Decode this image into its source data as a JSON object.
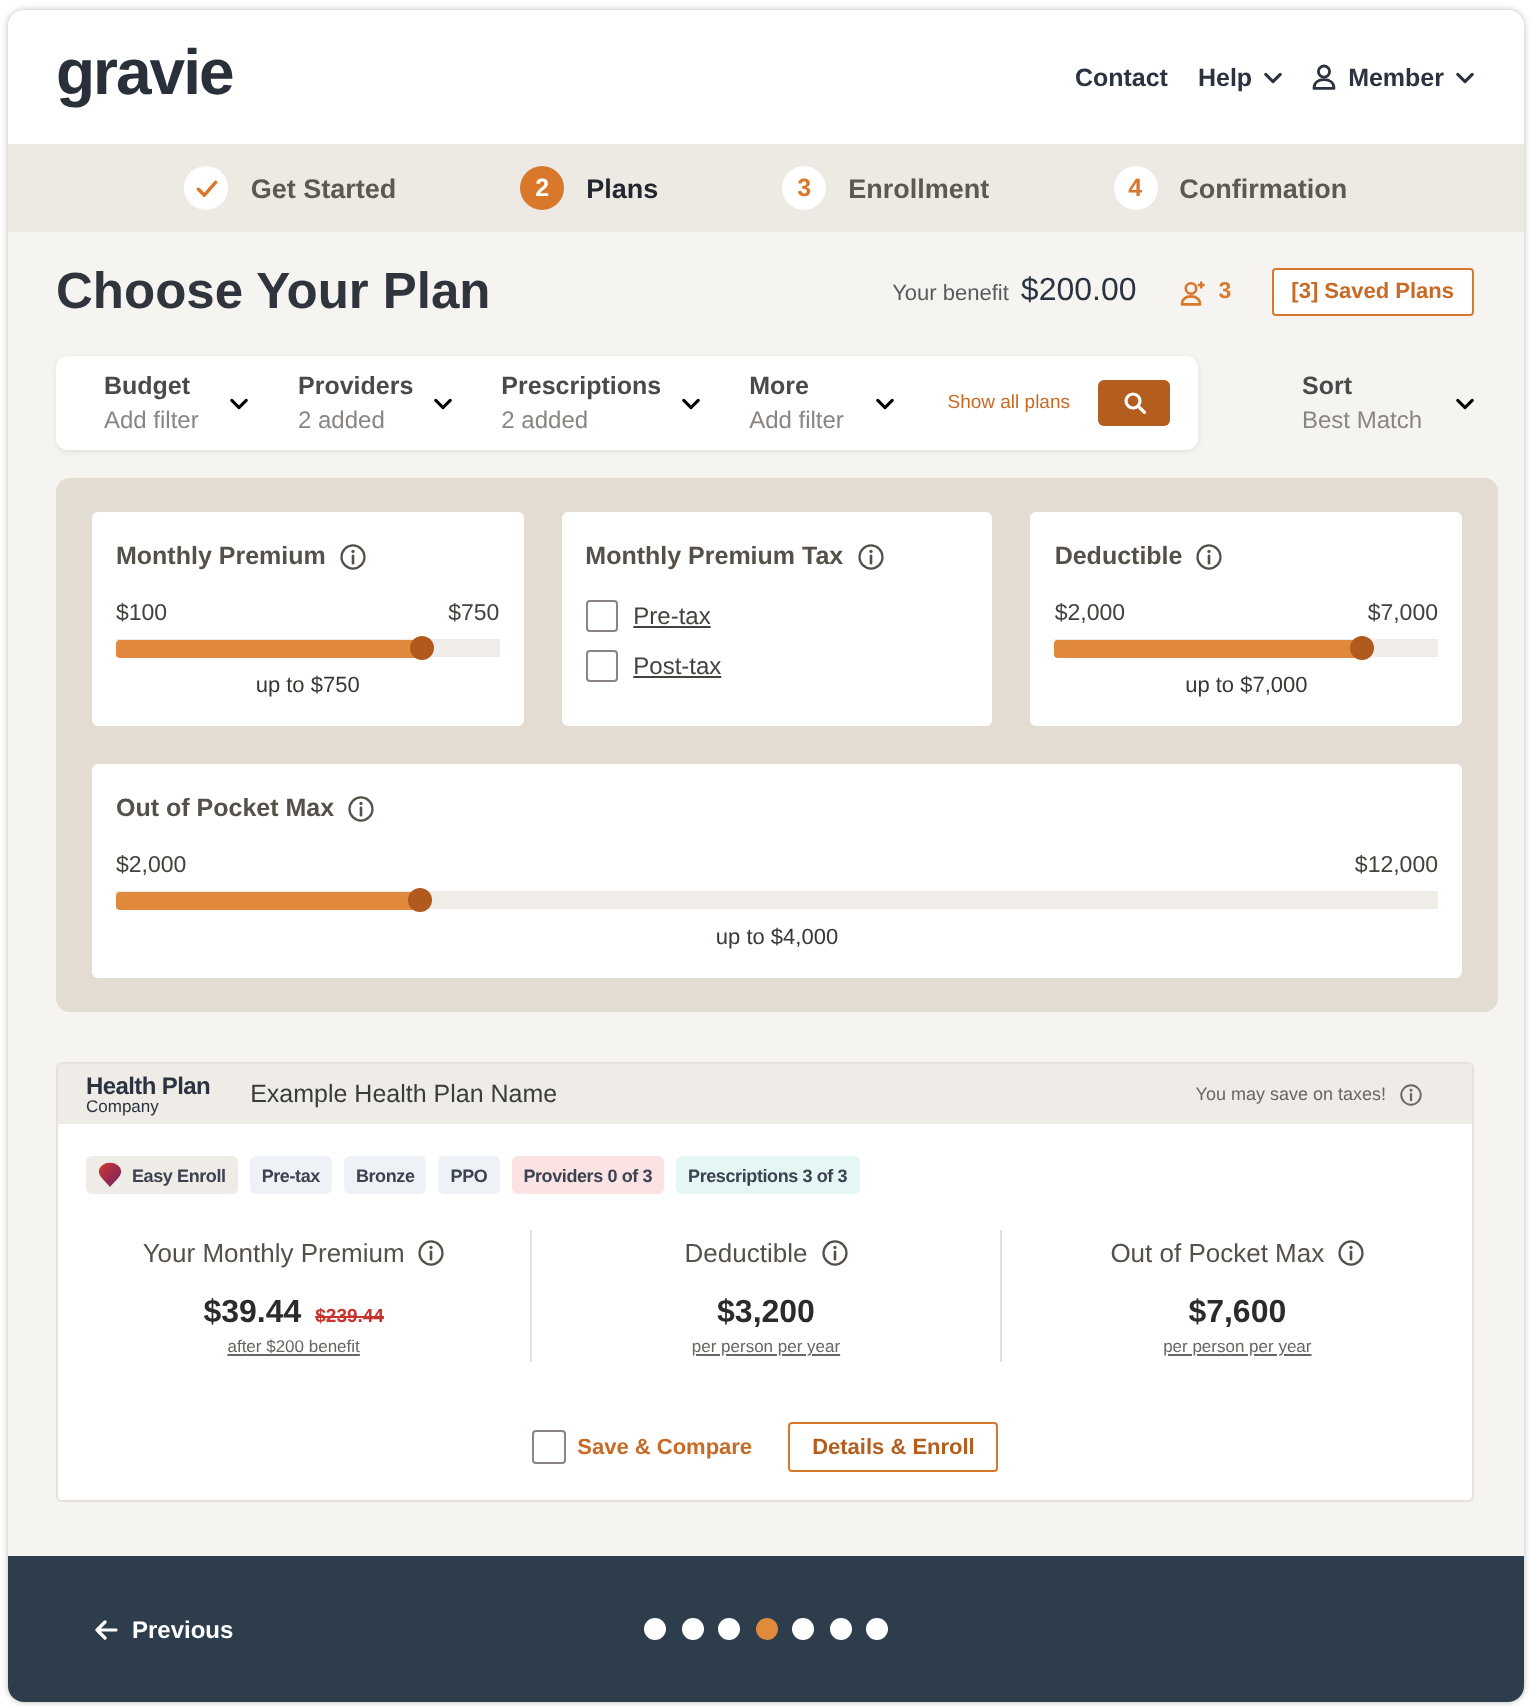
{
  "header": {
    "logo": "gravie",
    "nav": [
      {
        "kind": "link",
        "label": "Contact"
      },
      {
        "kind": "menu",
        "label": "Help"
      },
      {
        "kind": "account",
        "label": "Member"
      }
    ]
  },
  "steps": [
    {
      "completed": true,
      "selected": false,
      "label": "Get Started"
    },
    {
      "completed": false,
      "selected": true,
      "number": "2",
      "label": "Plans"
    },
    {
      "completed": false,
      "selected": false,
      "number": "3",
      "label": "Enrollment"
    },
    {
      "completed": false,
      "selected": false,
      "number": "4",
      "label": "Confirmation"
    }
  ],
  "title_bar": {
    "title": "Choose Your Plan",
    "benefit_label": "Your benefit",
    "benefit_amount": "$200.00",
    "member_count": "3",
    "saved_plans_button": "[3] Saved Plans"
  },
  "filter_bar": {
    "filters": [
      {
        "label": "Budget",
        "value": "Add filter"
      },
      {
        "label": "Providers",
        "value": "2 added"
      },
      {
        "label": "Prescriptions",
        "value": "2 added"
      },
      {
        "label": "More",
        "value": "Add filter"
      }
    ],
    "show_all_link": "Show all plans",
    "sort": {
      "label": "Sort",
      "value": "Best Match"
    }
  },
  "filter_panel": {
    "rows": [
      [
        {
          "kind": "slider",
          "title": "Monthly Premium",
          "min_label": "$100",
          "max_label": "$750",
          "level": 0.8,
          "reading": "up to $750"
        },
        {
          "kind": "checkboxes",
          "title": "Monthly Premium Tax",
          "options": [
            {
              "label": "Pre-tax",
              "checked": false
            },
            {
              "label": "Post-tax",
              "checked": false
            }
          ]
        },
        {
          "kind": "slider",
          "title": "Deductible",
          "min_label": "$2,000",
          "max_label": "$7,000",
          "level": 0.8,
          "reading": "up to $7,000"
        }
      ],
      [
        {
          "kind": "slider",
          "title": "Out of Pocket Max",
          "min_label": "$2,000",
          "max_label": "$12,000",
          "level": 0.23,
          "reading": "up to $4,000"
        }
      ]
    ]
  },
  "plan": {
    "logo_title": "Health Plan",
    "logo_subtitle": "Company",
    "name": "Example Health Plan Name",
    "tax_note": "You may save on taxes!",
    "tags": [
      {
        "kind": "featured",
        "label": "Easy Enroll",
        "color": "#efebe6"
      },
      {
        "kind": "plain",
        "label": "Pre-tax",
        "color": "#eef1f6"
      },
      {
        "kind": "plain",
        "label": "Bronze",
        "color": "#eef1f6"
      },
      {
        "kind": "plain",
        "label": "PPO",
        "color": "#eef1f6"
      },
      {
        "kind": "plain",
        "label": "Providers 0 of 3",
        "color": "#fbe3e3"
      },
      {
        "kind": "plain",
        "label": "Prescriptions 3 of 3",
        "color": "#e5f7f4"
      }
    ],
    "stats": [
      {
        "label": "Your Monthly Premium",
        "value": "$39.44",
        "original_value": "$239.44",
        "note": "after $200 benefit"
      },
      {
        "label": "Deductible",
        "value": "$3,200",
        "note": "per person per year"
      },
      {
        "label": "Out of Pocket Max",
        "value": "$7,600",
        "note": "per person per year"
      }
    ],
    "compare": {
      "label": "Save & Compare",
      "checked": false
    },
    "enroll_button": "Details & Enroll"
  },
  "footer": {
    "previous": "Previous",
    "dots": [
      {
        "selected": false
      },
      {
        "selected": false
      },
      {
        "selected": false
      },
      {
        "selected": true
      },
      {
        "selected": false
      },
      {
        "selected": false
      },
      {
        "selected": false
      }
    ]
  }
}
